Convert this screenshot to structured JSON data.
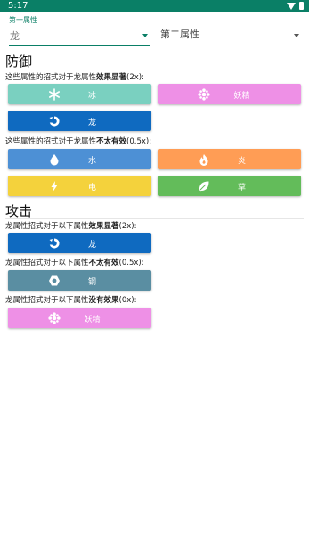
{
  "status_bar": {
    "time": "5:17",
    "icons": [
      "wifi-icon",
      "battery-icon"
    ]
  },
  "selectors": {
    "first": {
      "caption": "第一属性",
      "value": "龙"
    },
    "second": {
      "value": "第二属性"
    }
  },
  "defense": {
    "title": "防御",
    "groups": [
      {
        "label_pre": "这些属性的招式对于龙属性",
        "label_bold": "效果显著",
        "label_post": "(2x):",
        "types": [
          {
            "name": "冰",
            "icon": "snowflake-icon",
            "color": "#7ad0c0"
          },
          {
            "name": "妖精",
            "icon": "fairy-icon",
            "color": "#ee90e6"
          },
          {
            "name": "龙",
            "icon": "dragon-icon",
            "color": "#0f6ac0"
          }
        ]
      },
      {
        "label_pre": "这些属性的招式对于龙属性",
        "label_bold": "不太有效",
        "label_post": "(0.5x):",
        "types": [
          {
            "name": "水",
            "icon": "water-drop-icon",
            "color": "#4d90d5"
          },
          {
            "name": "炎",
            "icon": "fire-icon",
            "color": "#ff9d55"
          },
          {
            "name": "电",
            "icon": "lightning-icon",
            "color": "#f4d23c"
          },
          {
            "name": "草",
            "icon": "leaf-icon",
            "color": "#63bc5a"
          }
        ]
      }
    ]
  },
  "attack": {
    "title": "攻击",
    "groups": [
      {
        "label_pre": "龙属性招式对于以下属性",
        "label_bold": "效果显著",
        "label_post": "(2x):",
        "types": [
          {
            "name": "龙",
            "icon": "dragon-icon",
            "color": "#0f6ac0"
          }
        ]
      },
      {
        "label_pre": "龙属性招式对于以下属性",
        "label_bold": "不太有效",
        "label_post": "(0.5x):",
        "types": [
          {
            "name": "钢",
            "icon": "steel-icon",
            "color": "#5a8ea2"
          }
        ]
      },
      {
        "label_pre": "龙属性招式对于以下属性",
        "label_bold": "没有效果",
        "label_post": "(0x):",
        "types": [
          {
            "name": "妖精",
            "icon": "fairy-icon",
            "color": "#ee90e6"
          }
        ]
      }
    ]
  }
}
